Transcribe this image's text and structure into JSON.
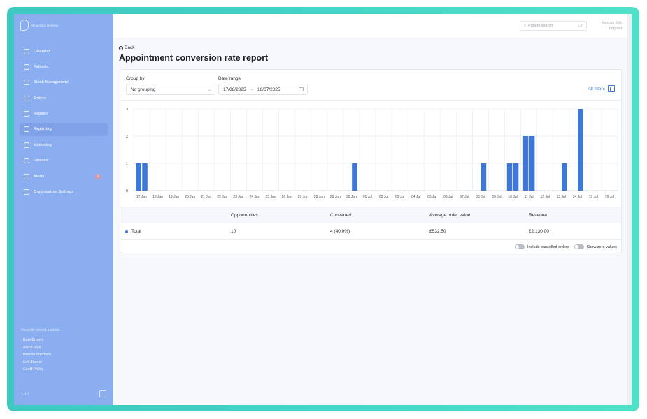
{
  "app": {
    "logo_text": "Whiddleby Hearing"
  },
  "sidebar": {
    "items": [
      {
        "label": "Calendar",
        "icon": "calendar-icon"
      },
      {
        "label": "Patients",
        "icon": "patients-icon"
      },
      {
        "label": "Stock Management",
        "icon": "stock-icon"
      },
      {
        "label": "Orders",
        "icon": "orders-icon"
      },
      {
        "label": "Repairs",
        "icon": "wrench-icon"
      },
      {
        "label": "Reporting",
        "icon": "chart-icon",
        "active": true
      },
      {
        "label": "Marketing",
        "icon": "mail-icon"
      },
      {
        "label": "Finance",
        "icon": "finance-icon"
      },
      {
        "label": "Alerts",
        "icon": "bell-icon",
        "badge": "3"
      },
      {
        "label": "Organisation Settings",
        "icon": "gear-icon"
      }
    ],
    "recent_title": "Recently viewed patients",
    "recent": [
      "- Kate Brown",
      "- Alan Lloyd",
      "- Brenda Sheffield",
      "- Eric Tanner",
      "- Geoff Philip"
    ],
    "footer": "1.0.0"
  },
  "topbar": {
    "search_placeholder": "Patient search",
    "search_shortcut": "Ctrl",
    "user_name": "Marcus Kirk",
    "logout": "Log out"
  },
  "page": {
    "back_label": "Back",
    "title": "Appointment conversion rate report"
  },
  "filters": {
    "group_by_label": "Group by",
    "group_by_value": "No grouping",
    "date_range_label": "Date range",
    "date_from": "17/06/2025",
    "date_arrow": "→",
    "date_to": "16/07/2025",
    "all_filters": "All filters"
  },
  "chart_data": {
    "type": "bar",
    "categories": [
      "17 Jun",
      "18 Jun",
      "19 Jun",
      "20 Jun",
      "21 Jun",
      "22 Jun",
      "23 Jun",
      "24 Jun",
      "25 Jun",
      "26 Jun",
      "27 Jun",
      "28 Jun",
      "29 Jun",
      "30 Jun",
      "01 Jul",
      "02 Jul",
      "03 Jul",
      "04 Jul",
      "05 Jul",
      "06 Jul",
      "07 Jul",
      "08 Jul",
      "09 Jul",
      "10 Jul",
      "11 Jul",
      "12 Jul",
      "13 Jul",
      "14 Jul",
      "15 Jul",
      "16 Jul"
    ],
    "series": [
      {
        "values": [
          1,
          0,
          0,
          0,
          0,
          0,
          0,
          0,
          0,
          0,
          0,
          0,
          0,
          0,
          0,
          0,
          0,
          0,
          0,
          0,
          0,
          0,
          0,
          1,
          2,
          0,
          0,
          0,
          0,
          0
        ]
      },
      {
        "values": [
          1,
          0,
          0,
          0,
          0,
          0,
          0,
          0,
          0,
          0,
          0,
          0,
          0,
          1,
          0,
          0,
          0,
          0,
          0,
          0,
          0,
          1,
          0,
          1,
          2,
          0,
          1,
          3,
          0,
          0
        ]
      }
    ],
    "yticks": [
      "0",
      "1",
      "2",
      "3"
    ],
    "ylim": [
      0,
      3
    ],
    "grid": true,
    "color": "#3d78d8"
  },
  "table": {
    "headers": [
      "Opportunities",
      "Converted",
      "Average order value",
      "Revenue"
    ],
    "row": {
      "label": "Total",
      "opportunities": "10",
      "converted": "4 (40.0%)",
      "aov": "£532.50",
      "revenue": "£2,130.00"
    }
  },
  "toggles": {
    "cancelled": "Include cancelled orders",
    "zero": "Show zero values"
  }
}
